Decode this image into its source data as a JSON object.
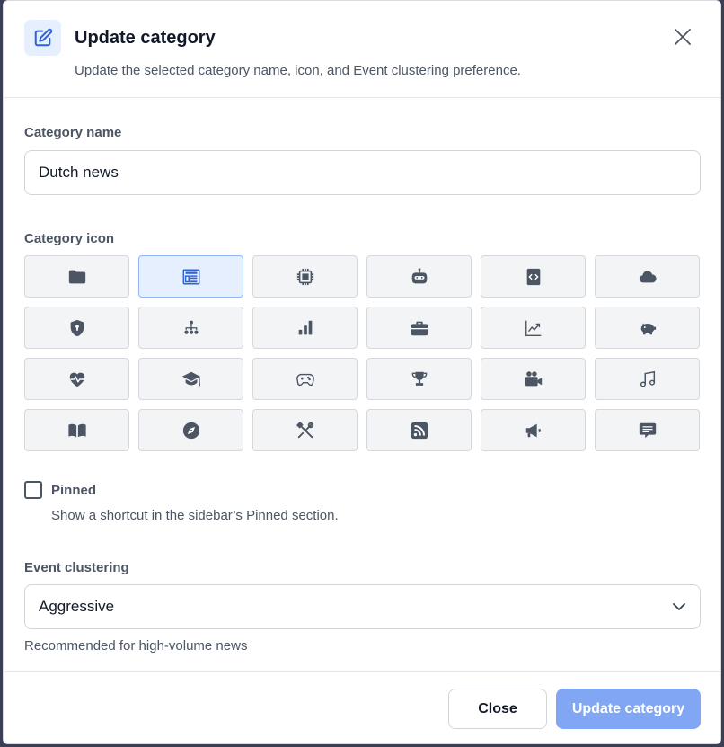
{
  "dialog": {
    "title": "Update category",
    "subtitle": "Update the selected category name, icon, and Event clustering preference.",
    "header_icon": "edit-square-icon",
    "close_icon": "close-icon"
  },
  "name_field": {
    "label": "Category name",
    "value": "Dutch news"
  },
  "icon_picker": {
    "label": "Category icon",
    "selected": "newspaper-icon",
    "icons": [
      "folder-icon",
      "newspaper-icon",
      "cpu-chip-icon",
      "robot-icon",
      "code-file-icon",
      "cloud-icon",
      "shield-icon",
      "hierarchy-icon",
      "bar-chart-icon",
      "briefcase-icon",
      "line-chart-icon",
      "piggy-bank-icon",
      "heart-pulse-icon",
      "graduation-cap-icon",
      "gamepad-icon",
      "trophy-icon",
      "video-camera-icon",
      "music-note-icon",
      "book-icon",
      "compass-icon",
      "tools-icon",
      "rss-icon",
      "megaphone-icon",
      "comment-icon"
    ]
  },
  "pinned": {
    "label": "Pinned",
    "help": "Show a shortcut in the sidebar’s Pinned section.",
    "checked": false
  },
  "clustering": {
    "label": "Event clustering",
    "value": "Aggressive",
    "help": "Recommended for high-volume news"
  },
  "footer": {
    "close_label": "Close",
    "update_label": "Update category"
  },
  "colors": {
    "accent": "#3b6fe0",
    "update_button": "#80a6f4",
    "icon_gray": "#4b5563"
  }
}
